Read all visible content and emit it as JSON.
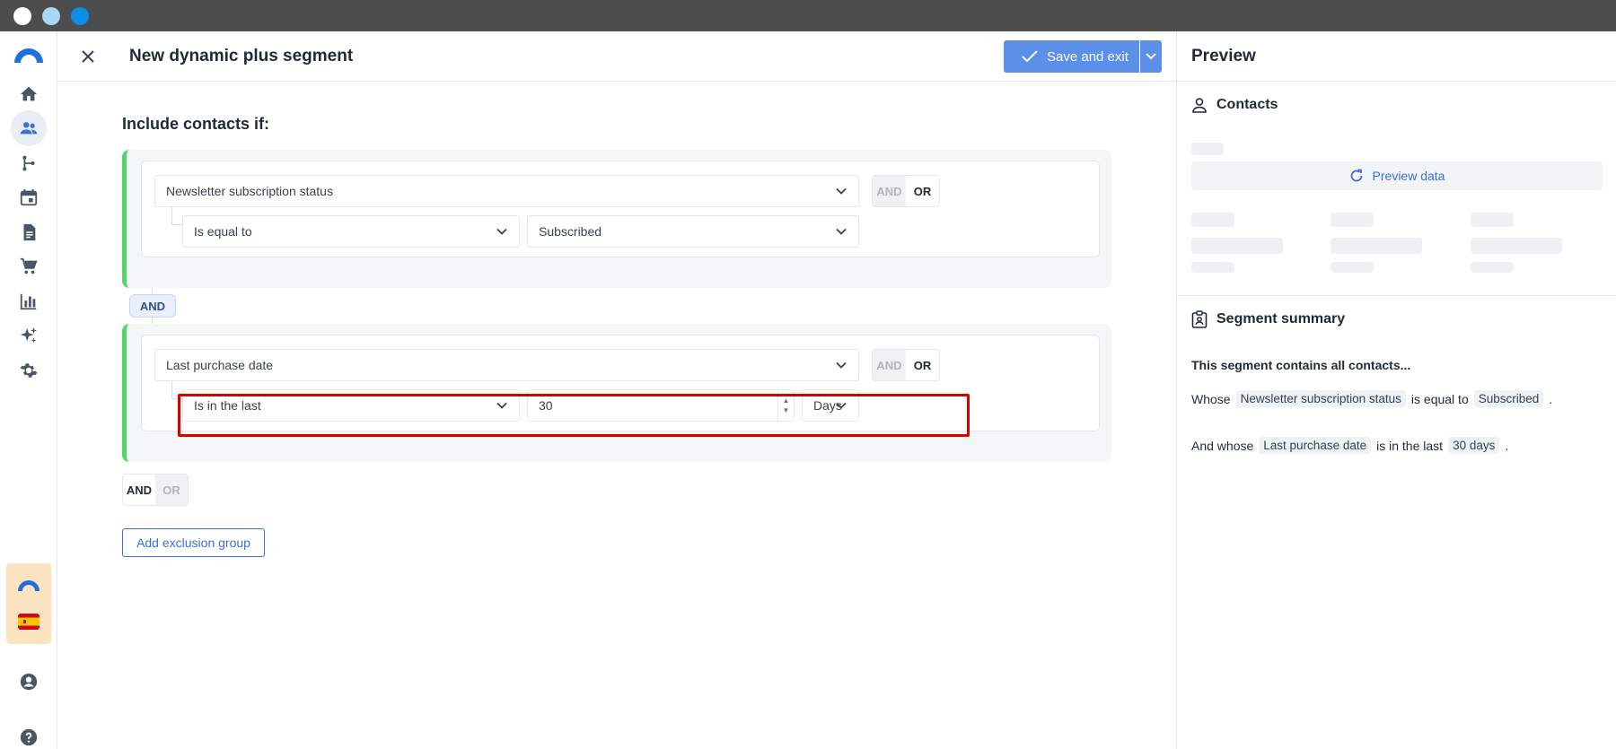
{
  "header": {
    "title": "New dynamic plus segment",
    "save_label": "Save and exit"
  },
  "main": {
    "include_title": "Include contacts if:",
    "group1": {
      "field": "Newsletter subscription status",
      "operator": "Is equal to",
      "value": "Subscribed",
      "and_label": "AND",
      "or_label": "OR"
    },
    "group_connector": "AND",
    "group2": {
      "field": "Last purchase date",
      "operator": "Is in the last",
      "amount": "30",
      "unit": "Days",
      "and_label": "AND",
      "or_label": "OR"
    },
    "bottom_and": "AND",
    "bottom_or": "OR",
    "exclusion_label": "Add exclusion group"
  },
  "preview": {
    "title": "Preview",
    "contacts_title": "Contacts",
    "preview_data_label": "Preview data",
    "summary_title": "Segment summary",
    "summary_intro": "This segment contains all contacts...",
    "line1": {
      "prefix": "Whose",
      "field": "Newsletter subscription status",
      "mid": "is equal to",
      "value": "Subscribed",
      "suffix": "."
    },
    "line2": {
      "prefix": "And whose",
      "field": "Last purchase date",
      "mid": "is in the last",
      "value": "30 days",
      "suffix": "."
    }
  },
  "colors": {
    "accent": "#5c8fe8",
    "group_border": "#53d769",
    "highlight": "#d90000",
    "promo_bg": "#fbe3c0"
  },
  "icons": {
    "sidebar": [
      "home-icon",
      "contacts-icon",
      "automation-icon",
      "calendar-icon",
      "document-icon",
      "cart-icon",
      "chart-icon",
      "sparkle-icon",
      "gear-icon",
      "account-icon",
      "help-icon"
    ]
  }
}
